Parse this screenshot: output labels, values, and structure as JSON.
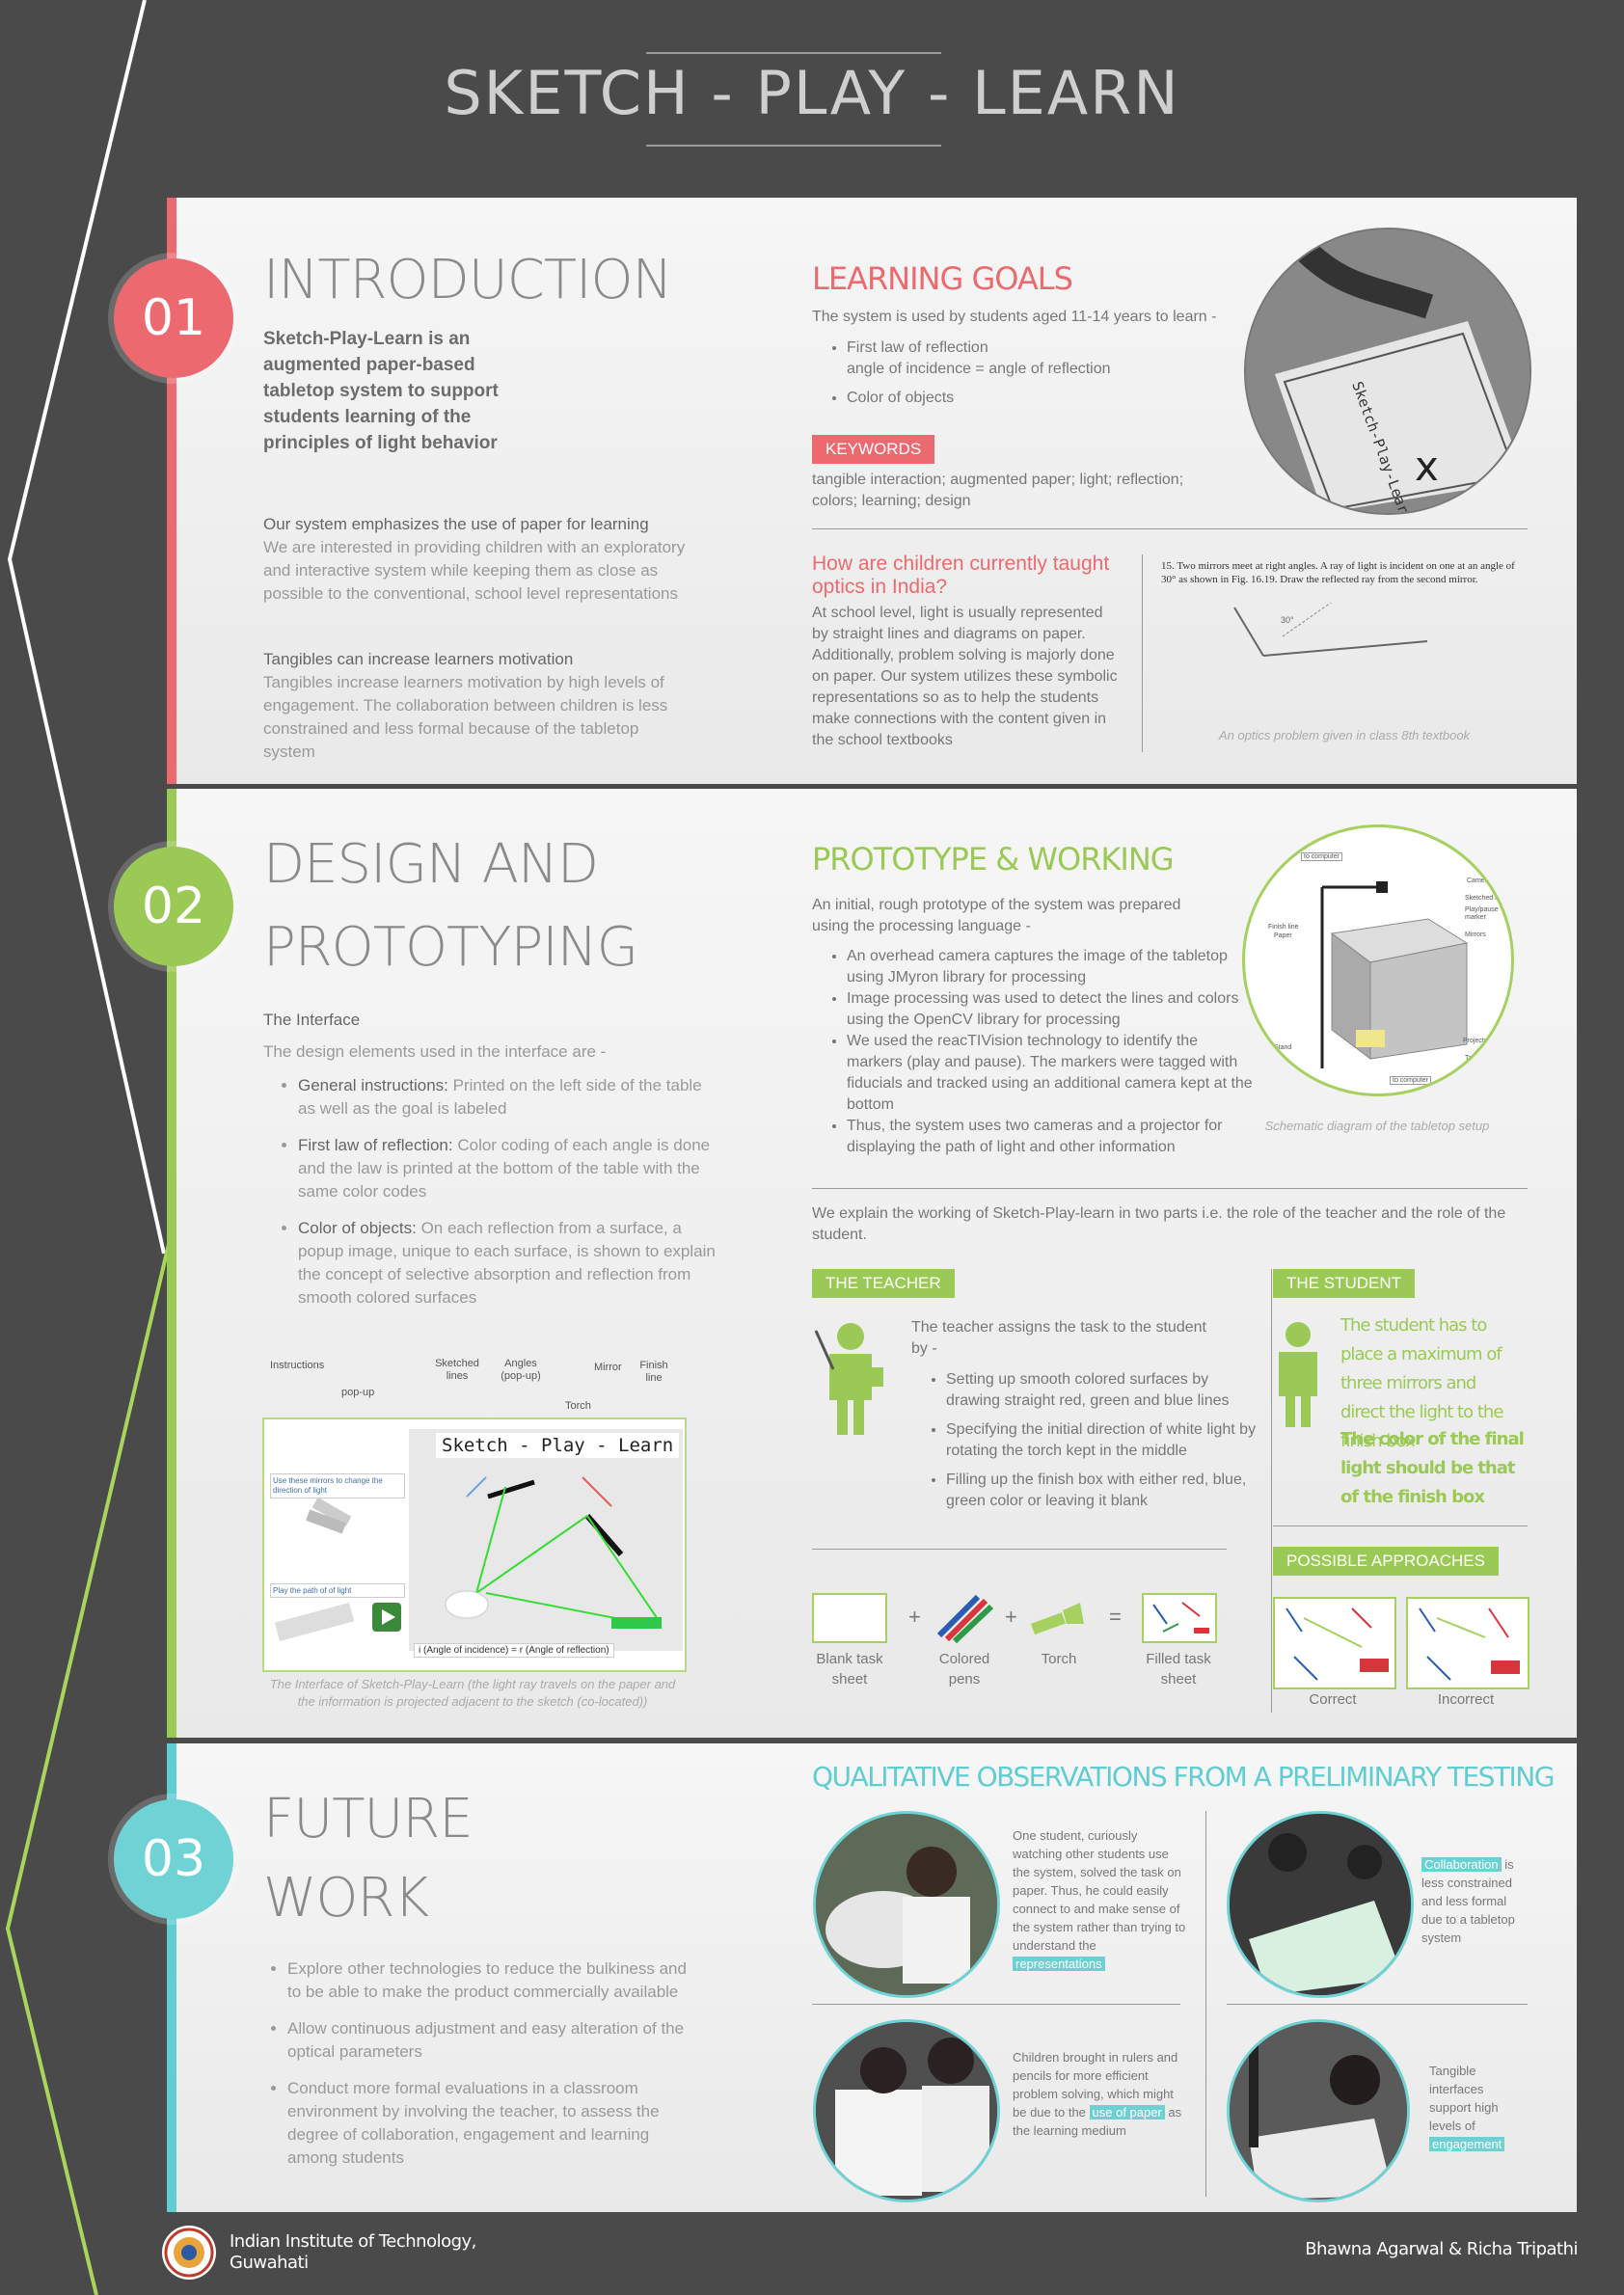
{
  "title": "SKETCH - PLAY - LEARN",
  "sections": {
    "intro": {
      "number": "01",
      "heading": "INTRODUCTION",
      "lead": "Sketch-Play-Learn is an augmented paper-based tabletop system to support students learning of the principles of light behavior",
      "p1_title": "Our system emphasizes the use of paper for learning",
      "p1_body": "We are interested in providing children with an exploratory and interactive system while keeping them as close as possible to the conventional, school level representations",
      "p2_title": "Tangibles can increase learners motivation",
      "p2_body": "Tangibles increase learners motivation by high levels of engagement. The collaboration between children is less constrained and less formal because of the tabletop system"
    },
    "goals": {
      "heading": "LEARNING GOALS",
      "intro": "The system is used by students aged 11-14 years to learn -",
      "item1a": "First law of reflection",
      "item1b": "angle of incidence = angle of reflection",
      "item2": "Color of objects",
      "keywords_label": "KEYWORDS",
      "keywords": "tangible interaction; augmented paper; light; reflection; colors; learning; design",
      "photo_text": "Sketch-Play-Learn"
    },
    "taught": {
      "heading": "How are children currently taught optics in India?",
      "body": "At school level, light is usually represented by straight lines and diagrams on paper. Additionally, problem solving is majorly done on paper. Our system utilizes these symbolic representations so as to help the students make connections with the content given in the school textbooks",
      "problem_num": "15.",
      "problem": "Two mirrors meet at right angles. A ray of light is incident on one at an angle of 30° as shown in Fig. 16.19. Draw the reflected ray from the second mirror.",
      "angle": "30°",
      "caption": "An optics problem given in class 8th textbook"
    },
    "design": {
      "number": "02",
      "heading1": "DESIGN AND",
      "heading2": "PROTOTYPING",
      "interface_title": "The Interface",
      "interface_intro": "The design elements used in the interface are -",
      "b1_bold": "General instructions:",
      "b1": " Printed on the left side of the table as well as the goal is labeled",
      "b2_bold": "First law of reflection:",
      "b2": " Color coding of each angle is done and the law is printed at the bottom of the table with the same color codes",
      "b3_bold": "Color of objects:",
      "b3": " On each reflection from a surface, a popup image, unique to each surface, is shown to explain the concept of selective absorption and reflection from smooth colored surfaces",
      "labels": {
        "instructions": "Instructions",
        "popup": "pop-up",
        "sketched": "Sketched lines",
        "angles": "Angles (pop-up)",
        "torch": "Torch",
        "mirror": "Mirror",
        "finish": "Finish line"
      },
      "shot_title": "Sketch - Play - Learn",
      "shot_instr": "Use these mirrors to change the direction of light",
      "shot_play": "Play the path of of light",
      "shot_law": "i (Angle of incidence) = r (Angle of reflection)",
      "caption": "The Interface of Sketch-Play-Learn (the light ray travels on the paper and the information is projected adjacent to the sketch (co-located))"
    },
    "prototype": {
      "heading": "PROTOTYPE & WORKING",
      "intro": "An initial, rough prototype of the system was prepared using the processing language -",
      "items": [
        "An overhead camera captures the image of the tabletop using JMyron library for processing",
        "Image processing was used to detect the lines and colors using the OpenCV library for processing",
        "We used the reacTIVision technology to identify the markers (play and pause). The markers were tagged with fiducials and tracked using an additional camera kept at the bottom",
        "Thus, the system uses two cameras and a projector for displaying the path of light and other information"
      ],
      "diagram_labels": [
        "to computer",
        "Camera",
        "Sketched lines",
        "Play/pause marker",
        "Finish line",
        "Paper",
        "Mirrors",
        "Stand",
        "Projector",
        "Table",
        "to computer"
      ],
      "caption": "Schematic diagram of the tabletop setup",
      "explain": "We explain the working of Sketch-Play-learn in two parts i.e. the role of the teacher and the role of the student."
    },
    "teacher": {
      "label": "THE TEACHER",
      "intro": "The teacher assigns the task to the student by -",
      "items": [
        "Setting up smooth colored surfaces by drawing straight red, green and blue lines",
        "Specifying the initial direction of white light by rotating the torch kept in the middle",
        "Filling up the finish box with either red, blue, green color or leaving it blank"
      ],
      "eq": {
        "a": "Blank task sheet",
        "plus1": "+",
        "b": "Colored pens",
        "plus2": "+",
        "c": "Torch",
        "equals": "=",
        "d": "Filled task sheet"
      }
    },
    "student": {
      "label": "THE STUDENT",
      "text1": "The student has to place a maximum of three mirrors and direct the light to the finish box",
      "text2": "The color of the final light should be that of the finish box",
      "approaches": "POSSIBLE APPROACHES",
      "correct": "Correct",
      "incorrect": "Incorrect"
    },
    "future": {
      "number": "03",
      "heading1": "FUTURE",
      "heading2": "WORK",
      "items": [
        "Explore other technologies to reduce the bulkiness and to be able to make the product commercially available",
        "Allow continuous adjustment and easy alteration of the optical parameters",
        "Conduct more formal evaluations in a classroom environment by involving the teacher, to assess the degree of collaboration, engagement and learning among students"
      ]
    },
    "observations": {
      "heading": "QUALITATIVE OBSERVATIONS FROM A PRELIMINARY TESTING",
      "o1": "One student, curiously watching other students use the system, solved the task on paper. Thus, he could easily connect to and make sense of the system rather than trying to understand the",
      "o1_hl": "representations",
      "o2_hl": "Collaboration",
      "o2": " is less constrained and less formal due to a tabletop system",
      "o3a": "Children brought in rulers and pencils for more efficient problem solving, which might be due to the",
      "o3_hl": "use of paper",
      "o3b": " as the learning medium",
      "o4": "Tangible interfaces support high levels of",
      "o4_hl": "engagement"
    }
  },
  "footer": {
    "institute1": "Indian Institute of Technology,",
    "institute2": "Guwahati",
    "authors": "Bhawna Agarwal & Richa Tripathi"
  },
  "colors": {
    "red": "#ec6a6f",
    "green": "#9bc955",
    "teal": "#5fcdd1",
    "bg": "#4a4a4a"
  }
}
